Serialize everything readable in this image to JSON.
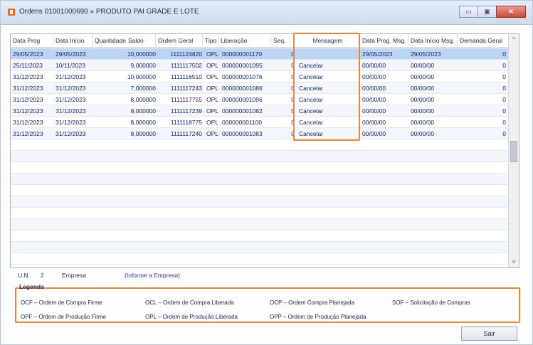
{
  "window": {
    "title": "Ordens 01001000690 » PRODUTO PAI GRADE E LOTE",
    "buttons": {
      "minimize": "▭",
      "maximize": "▣",
      "close": "✕"
    }
  },
  "grid": {
    "columns": [
      "Data Prog",
      "Data Início",
      "Quantidade",
      "Saldo",
      "Ordem Geral",
      "Tipo",
      "Liberação",
      "Seq.",
      "Mensagem",
      "Data Prog. Msg.",
      "Data Início Msg.",
      "Demanda Geral"
    ],
    "rows": [
      {
        "data_prog": "29/05/2023",
        "data_inicio": "29/05/2023",
        "quantidade": "10,000000",
        "ordem_geral": "1111124820",
        "tipo": "OPL",
        "liberacao": "000000001170",
        "seq": "0",
        "mensagem": "",
        "data_prog_msg": "29/05/2023",
        "data_inicio_msg": "29/05/2023",
        "demanda_geral": "0"
      },
      {
        "data_prog": "25/11/2023",
        "data_inicio": "10/11/2023",
        "quantidade": "9,000000",
        "ordem_geral": "1111117502",
        "tipo": "OPL",
        "liberacao": "000000001095",
        "seq": "0",
        "mensagem": "Cancelar",
        "data_prog_msg": "00/00/00",
        "data_inicio_msg": "00/00/00",
        "demanda_geral": "0"
      },
      {
        "data_prog": "31/12/2023",
        "data_inicio": "31/12/2023",
        "quantidade": "10,000000",
        "ordem_geral": "1111116510",
        "tipo": "OPL",
        "liberacao": "000000001076",
        "seq": "0",
        "mensagem": "Cancelar",
        "data_prog_msg": "00/00/00",
        "data_inicio_msg": "00/00/00",
        "demanda_geral": "0"
      },
      {
        "data_prog": "31/12/2023",
        "data_inicio": "31/12/2023",
        "quantidade": "7,000000",
        "ordem_geral": "1111117243",
        "tipo": "OPL",
        "liberacao": "000000001086",
        "seq": "0",
        "mensagem": "Cancelar",
        "data_prog_msg": "00/00/00",
        "data_inicio_msg": "00/00/00",
        "demanda_geral": "0"
      },
      {
        "data_prog": "31/12/2023",
        "data_inicio": "31/12/2023",
        "quantidade": "8,000000",
        "ordem_geral": "1111117755",
        "tipo": "OPL",
        "liberacao": "000000001096",
        "seq": "0",
        "mensagem": "Cancelar",
        "data_prog_msg": "00/00/00",
        "data_inicio_msg": "00/00/00",
        "demanda_geral": "0"
      },
      {
        "data_prog": "31/12/2023",
        "data_inicio": "31/12/2023",
        "quantidade": "9,000000",
        "ordem_geral": "1111117239",
        "tipo": "OPL",
        "liberacao": "000000001082",
        "seq": "0",
        "mensagem": "Cancelar",
        "data_prog_msg": "00/00/00",
        "data_inicio_msg": "00/00/00",
        "demanda_geral": "0"
      },
      {
        "data_prog": "31/12/2023",
        "data_inicio": "31/12/2023",
        "quantidade": "8,000000",
        "ordem_geral": "1111118775",
        "tipo": "OPL",
        "liberacao": "000000001100",
        "seq": "0",
        "mensagem": "Cancelar",
        "data_prog_msg": "00/00/00",
        "data_inicio_msg": "00/00/00",
        "demanda_geral": "0"
      },
      {
        "data_prog": "31/12/2023",
        "data_inicio": "31/12/2023",
        "quantidade": "8,000000",
        "ordem_geral": "1111117240",
        "tipo": "OPL",
        "liberacao": "000000001083",
        "seq": "0",
        "mensagem": "Cancelar",
        "data_prog_msg": "00/00/00",
        "data_inicio_msg": "00/00/00",
        "demanda_geral": "0"
      }
    ],
    "scroll": {
      "up": "^",
      "down": "v"
    }
  },
  "info": {
    "un_label": "U.N",
    "un_value": "2",
    "empresa_label": "Empresa",
    "empresa_value": "(Informe a Empresa)"
  },
  "legend": {
    "title": "Legenda",
    "items": [
      "OCF – Ordem de Compra Firme",
      "OCL – Ordem de Compra Liberada",
      "OCP – Ordem Compra Planejada",
      "SOF – Solicitação de Compras",
      "OPF – Ordem de Produção Firme",
      "OPL – Ordem de Produção Liberada",
      "OPP – Ordem de Produção Planejada"
    ]
  },
  "footer": {
    "exit_label": "Sair"
  },
  "colors": {
    "highlight": "#f0843c",
    "selected_row": "#bcd6f2",
    "value_text": "#1c2370"
  }
}
